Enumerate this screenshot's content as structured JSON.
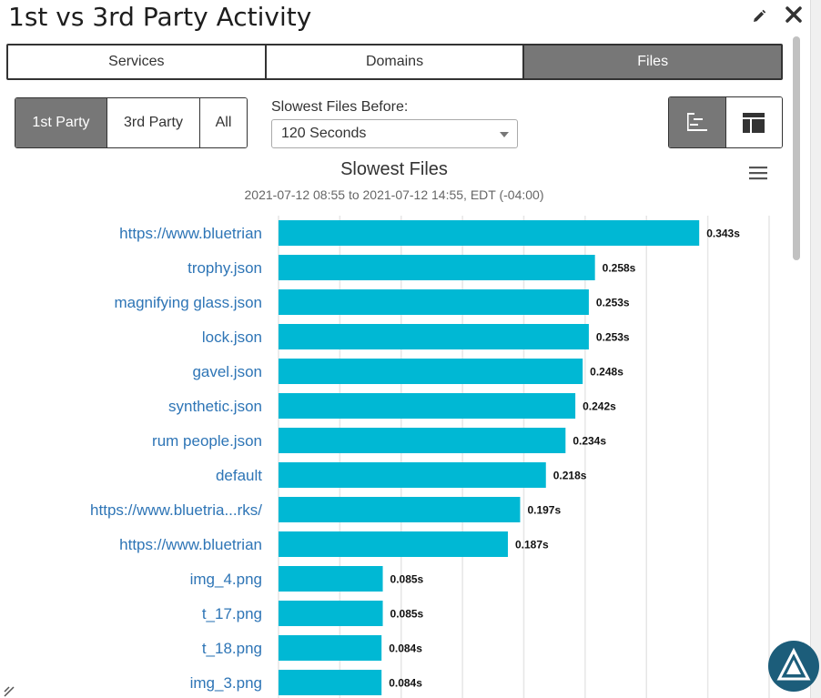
{
  "header": {
    "title": "1st vs 3rd Party Activity"
  },
  "tabs": [
    {
      "label": "Services",
      "active": false
    },
    {
      "label": "Domains",
      "active": false
    },
    {
      "label": "Files",
      "active": true
    }
  ],
  "party_filter": [
    {
      "label": "1st Party",
      "active": true
    },
    {
      "label": "3rd Party",
      "active": false
    },
    {
      "label": "All",
      "active": false
    }
  ],
  "slowest_before": {
    "label": "Slowest Files Before:",
    "value": "120 Seconds"
  },
  "icons": {
    "edit": "pencil-icon",
    "close": "close-icon",
    "chart_view": "bar-chart-view-icon",
    "table_view": "table-view-icon",
    "menu": "hamburger-menu-icon",
    "logo": "brand-logo-icon"
  },
  "colors": {
    "bar": "#00b8d4",
    "label": "#2e75b6",
    "active_button": "#777777"
  },
  "chart_data": {
    "type": "bar",
    "orientation": "horizontal",
    "title": "Slowest Files",
    "subtitle": "2021-07-12 08:55 to 2021-07-12 14:55, EDT (-04:00)",
    "categories": [
      "https://www.bluetrian",
      "trophy.json",
      "magnifying glass.json",
      "lock.json",
      "gavel.json",
      "synthetic.json",
      "rum people.json",
      "default",
      "https://www.bluetria...rks/",
      "https://www.bluetrian",
      "img_4.png",
      "t_17.png",
      "t_18.png",
      "img_3.png"
    ],
    "values": [
      0.343,
      0.258,
      0.253,
      0.253,
      0.248,
      0.242,
      0.234,
      0.218,
      0.197,
      0.187,
      0.085,
      0.085,
      0.084,
      0.084
    ],
    "data_labels": [
      "0.343s",
      "0.258s",
      "0.253s",
      "0.253s",
      "0.248s",
      "0.242s",
      "0.234s",
      "0.218s",
      "0.197s",
      "0.187s",
      "0.085s",
      "0.085s",
      "0.084s",
      "0.084s"
    ],
    "xlim": [
      0,
      0.4
    ],
    "grid": true
  }
}
